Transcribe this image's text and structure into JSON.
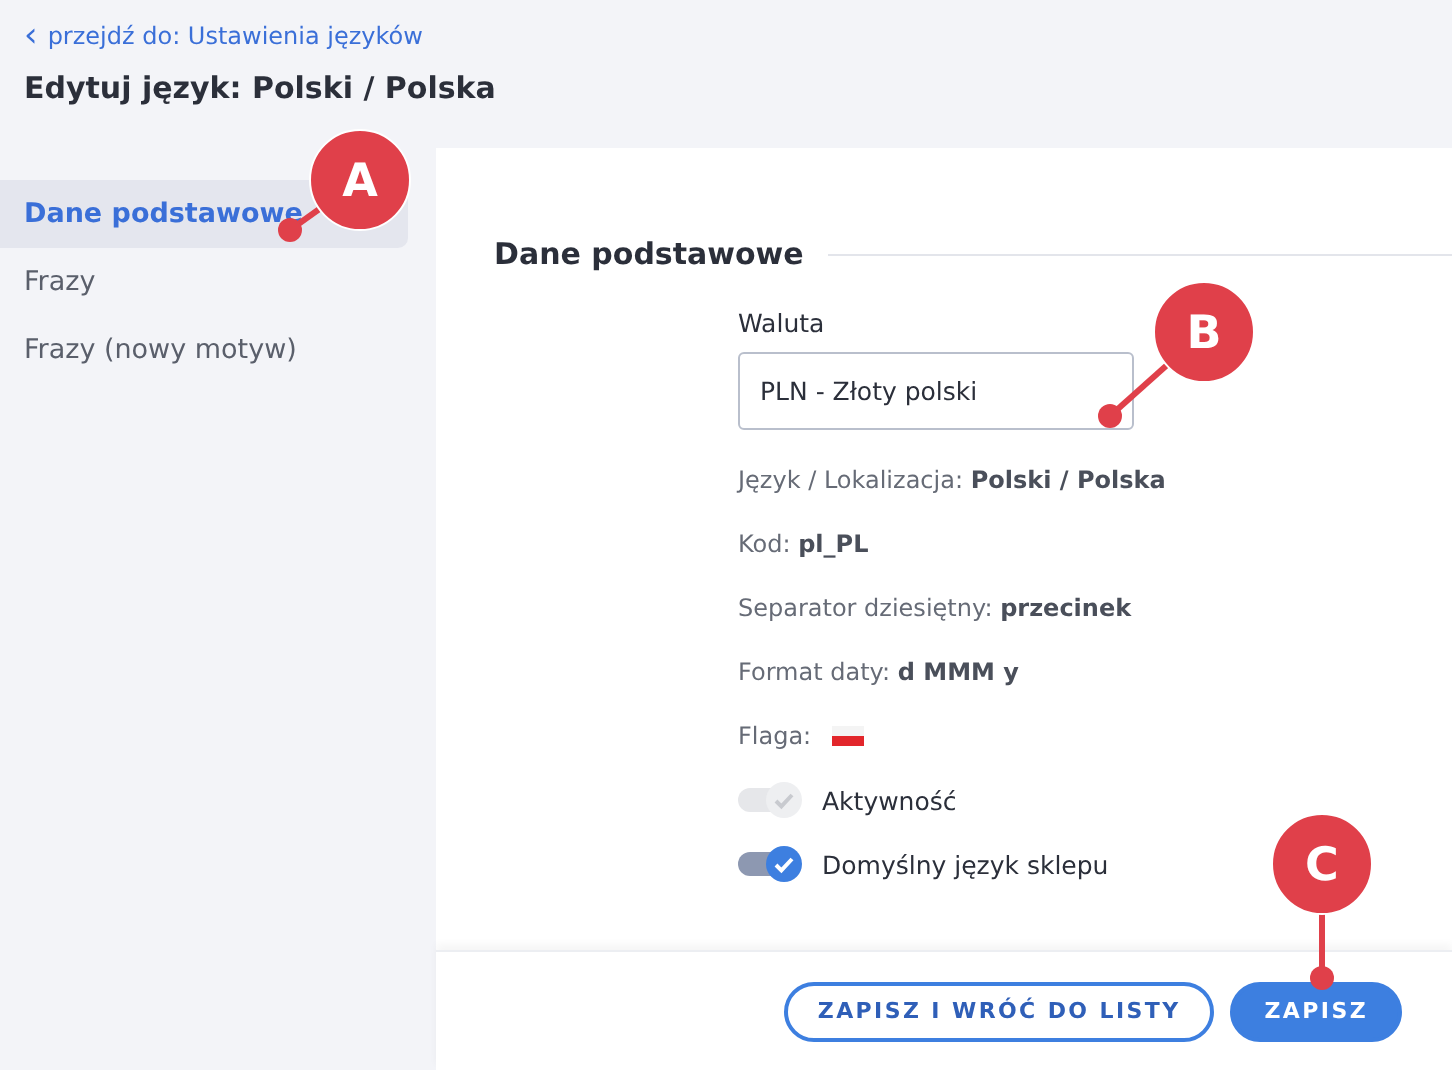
{
  "back_link": {
    "icon": "‹",
    "label": "przejdź do: Ustawienia języków"
  },
  "title": "Edytuj język: Polski / Polska",
  "sidebar": {
    "items": [
      {
        "label": "Dane podstawowe",
        "selected": true
      },
      {
        "label": "Frazy",
        "selected": false
      },
      {
        "label": "Frazy (nowy motyw)",
        "selected": false
      }
    ]
  },
  "section": {
    "heading": "Dane podstawowe",
    "currency": {
      "label": "Waluta",
      "value": "PLN - Złoty polski"
    },
    "info": [
      "Język / Lokalizacja: **Polski / Polska**",
      "Kod: **pl_PL**",
      "Separator dziesiętny: **przecinek**",
      "Format daty: **d MMM y**"
    ],
    "flag": {
      "label": "Flaga:"
    },
    "toggles": [
      {
        "label": "Aktywność",
        "on": true,
        "disabled": true
      },
      {
        "label": "Domyślny język sklepu",
        "on": true,
        "disabled": false
      }
    ]
  },
  "footer": {
    "buttons": [
      {
        "label": "ZAPISZ I WRÓĆ DO LISTY",
        "kind": "outline"
      },
      {
        "label": "ZAPISZ",
        "kind": "primary"
      }
    ]
  },
  "callouts": [
    {
      "letter": "A"
    },
    {
      "letter": "B"
    },
    {
      "letter": "C"
    }
  ]
}
